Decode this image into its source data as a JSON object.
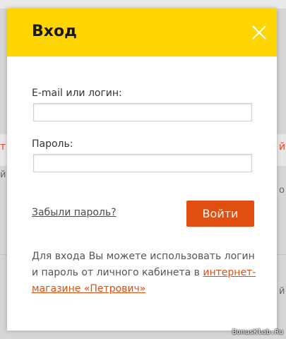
{
  "modal": {
    "title": "Вход",
    "close_icon": "close-x-icon"
  },
  "form": {
    "email_label": "E-mail или логин:",
    "email_value": "",
    "password_label": "Пароль:",
    "password_value": "",
    "forgot_link": "Забыли пароль?",
    "submit_label": "Войти"
  },
  "info": {
    "text": "Для входа Вы можете использовать логин и пароль от личного кабинета в ",
    "link": "интернет-магазине «Петрович»"
  },
  "watermark": "BonusKlab.Ru",
  "colors": {
    "header_bg": "#ffd500",
    "accent": "#e04e12"
  }
}
